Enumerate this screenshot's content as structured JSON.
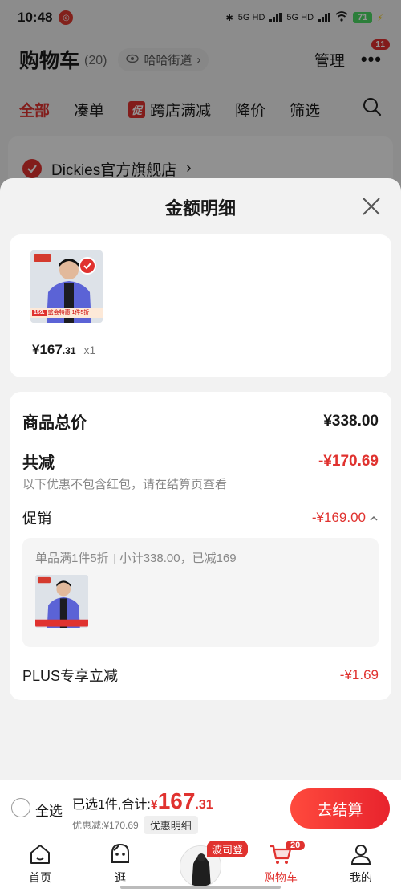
{
  "status_bar": {
    "time": "10:48",
    "notif_glyph": "◎",
    "net1": "5G HD",
    "net2": "5G HD",
    "battery": "71"
  },
  "header": {
    "title": "购物车",
    "count": "(20)",
    "location": "哈哈街道",
    "manage": "管理",
    "more_badge": "11"
  },
  "tabs": [
    {
      "label": "全部",
      "active": true
    },
    {
      "label": "凑单"
    },
    {
      "label": "跨店满减",
      "tag": "促"
    },
    {
      "label": "降价"
    },
    {
      "label": "筛选"
    }
  ],
  "store": {
    "name": "Dickies官方旗舰店"
  },
  "sheet": {
    "title": "金额明细",
    "product": {
      "price_main": "¥167",
      "price_dec": ".31",
      "qty": "x1",
      "tag_price": "159.",
      "tag_text": "盛会特惠 1件5折"
    },
    "goods_total_label": "商品总价",
    "goods_total_value": "¥338.00",
    "reduce_label": "共减",
    "reduce_value": "-¥170.69",
    "reduce_note": "以下优惠不包含红包，请在结算页查看",
    "promo_label": "促销",
    "promo_value": "-¥169.00",
    "promo_rule": "单品满1件5折",
    "promo_detail": "小计338.00，已减169",
    "plus_label": "PLUS专享立减",
    "plus_value": "-¥1.69"
  },
  "checkout": {
    "select_all": "全选",
    "selected_prefix": "已选1件,合计:",
    "total_symbol": "¥",
    "total_main": "167",
    "total_dec": ".31",
    "discount_text": "优惠减:¥170.69",
    "detail_button": "优惠明细",
    "go_button": "去结算"
  },
  "nav": [
    {
      "label": "首页"
    },
    {
      "label": "逛"
    },
    {
      "label": "",
      "tag": "波司登"
    },
    {
      "label": "购物车",
      "badge": "20",
      "active": true
    },
    {
      "label": "我的"
    }
  ],
  "colors": {
    "accent": "#e0322f"
  }
}
